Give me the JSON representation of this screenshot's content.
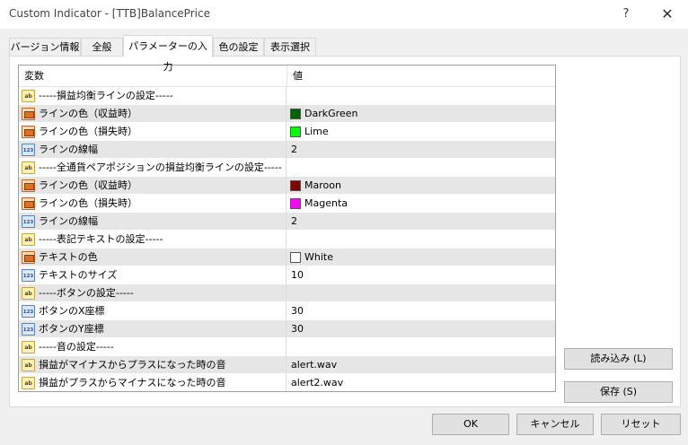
{
  "window": {
    "title": "Custom Indicator - [TTB]BalancePrice",
    "help": "?",
    "close": "✕"
  },
  "tabs": [
    {
      "label": "バージョン情報",
      "active": false
    },
    {
      "label": "全般",
      "active": false
    },
    {
      "label": "パラメーターの入力",
      "active": true
    },
    {
      "label": "色の設定",
      "active": false
    },
    {
      "label": "表示選択",
      "active": false
    }
  ],
  "grid": {
    "col_name": "変数",
    "col_value": "値",
    "rows": [
      {
        "type": "string",
        "type_label": "ab",
        "name": "-----損益均衡ラインの設定-----",
        "value": ""
      },
      {
        "type": "color",
        "type_label": "",
        "name": "ラインの色（収益時）",
        "value": "DarkGreen",
        "swatch": "#006400"
      },
      {
        "type": "color",
        "type_label": "",
        "name": "ラインの色（損失時）",
        "value": "Lime",
        "swatch": "#00ff00"
      },
      {
        "type": "number",
        "type_label": "123",
        "name": "ラインの線幅",
        "value": "2"
      },
      {
        "type": "string",
        "type_label": "ab",
        "name": "-----全通貨ペアポジションの損益均衡ラインの設定-----",
        "value": ""
      },
      {
        "type": "color",
        "type_label": "",
        "name": "ラインの色（収益時）",
        "value": "Maroon",
        "swatch": "#800000"
      },
      {
        "type": "color",
        "type_label": "",
        "name": "ラインの色（損失時）",
        "value": "Magenta",
        "swatch": "#ff00ff"
      },
      {
        "type": "number",
        "type_label": "123",
        "name": "ラインの線幅",
        "value": "2"
      },
      {
        "type": "string",
        "type_label": "ab",
        "name": "-----表記テキストの設定-----",
        "value": ""
      },
      {
        "type": "color",
        "type_label": "",
        "name": "テキストの色",
        "value": "White",
        "swatch": "#ffffff"
      },
      {
        "type": "number",
        "type_label": "123",
        "name": "テキストのサイズ",
        "value": "10"
      },
      {
        "type": "string",
        "type_label": "ab",
        "name": "-----ボタンの設定-----",
        "value": ""
      },
      {
        "type": "number",
        "type_label": "123",
        "name": "ボタンのX座標",
        "value": "30"
      },
      {
        "type": "number",
        "type_label": "123",
        "name": "ボタンのY座標",
        "value": "30"
      },
      {
        "type": "string",
        "type_label": "ab",
        "name": "-----音の設定-----",
        "value": ""
      },
      {
        "type": "string",
        "type_label": "ab",
        "name": "損益がマイナスからプラスになった時の音",
        "value": "alert.wav"
      },
      {
        "type": "string",
        "type_label": "ab",
        "name": "損益がプラスからマイナスになった時の音",
        "value": "alert2.wav"
      }
    ]
  },
  "side_buttons": {
    "load": "読み込み (L)",
    "save": "保存 (S)"
  },
  "footer": {
    "ok": "OK",
    "cancel": "キャンセル",
    "reset": "リセット"
  }
}
